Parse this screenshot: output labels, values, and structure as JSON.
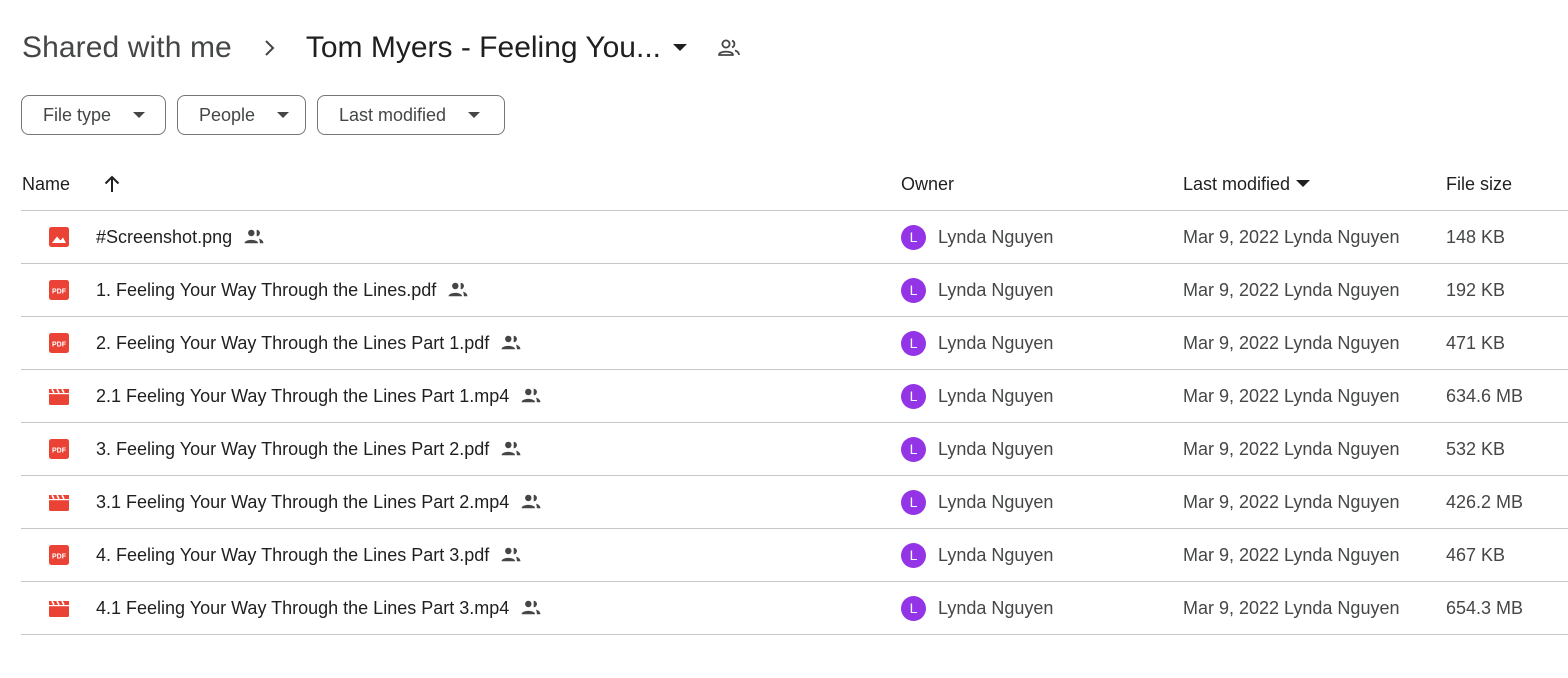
{
  "breadcrumb": {
    "root": "Shared with me",
    "current": "Tom Myers - Feeling You..."
  },
  "filters": [
    {
      "label": "File type"
    },
    {
      "label": "People"
    },
    {
      "label": "Last modified"
    }
  ],
  "columns": {
    "name": "Name",
    "owner": "Owner",
    "last_modified": "Last modified",
    "file_size": "File size"
  },
  "colors": {
    "file_icon_red": "#ea4335",
    "avatar_purple": "#9334e6",
    "divider": "#c4c7c5"
  },
  "files": [
    {
      "icon": "image-icon",
      "name": "#Screenshot.png",
      "owner_initial": "L",
      "owner": "Lynda Nguyen",
      "modified": "Mar 9, 2022 Lynda Nguyen",
      "size": "148 KB"
    },
    {
      "icon": "pdf-icon",
      "name": "1. Feeling Your Way Through the Lines.pdf",
      "owner_initial": "L",
      "owner": "Lynda Nguyen",
      "modified": "Mar 9, 2022 Lynda Nguyen",
      "size": "192 KB"
    },
    {
      "icon": "pdf-icon",
      "name": "2. Feeling Your Way Through the Lines Part 1.pdf",
      "owner_initial": "L",
      "owner": "Lynda Nguyen",
      "modified": "Mar 9, 2022 Lynda Nguyen",
      "size": "471 KB"
    },
    {
      "icon": "video-icon",
      "name": "2.1 Feeling Your Way Through the Lines Part 1.mp4",
      "owner_initial": "L",
      "owner": "Lynda Nguyen",
      "modified": "Mar 9, 2022 Lynda Nguyen",
      "size": "634.6 MB"
    },
    {
      "icon": "pdf-icon",
      "name": "3. Feeling Your Way Through the Lines Part 2.pdf",
      "owner_initial": "L",
      "owner": "Lynda Nguyen",
      "modified": "Mar 9, 2022 Lynda Nguyen",
      "size": "532 KB"
    },
    {
      "icon": "video-icon",
      "name": "3.1 Feeling Your Way Through the Lines Part 2.mp4",
      "owner_initial": "L",
      "owner": "Lynda Nguyen",
      "modified": "Mar 9, 2022 Lynda Nguyen",
      "size": "426.2 MB"
    },
    {
      "icon": "pdf-icon",
      "name": "4. Feeling Your Way Through the Lines Part 3.pdf",
      "owner_initial": "L",
      "owner": "Lynda Nguyen",
      "modified": "Mar 9, 2022 Lynda Nguyen",
      "size": "467 KB"
    },
    {
      "icon": "video-icon",
      "name": "4.1 Feeling Your Way Through the Lines Part 3.mp4",
      "owner_initial": "L",
      "owner": "Lynda Nguyen",
      "modified": "Mar 9, 2022 Lynda Nguyen",
      "size": "654.3 MB"
    }
  ]
}
